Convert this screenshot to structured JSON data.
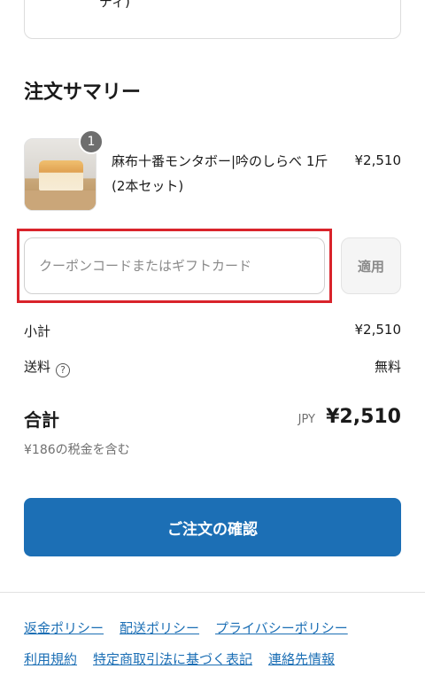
{
  "previous_card": {
    "text": "ディ)"
  },
  "summary": {
    "title": "注文サマリー"
  },
  "product": {
    "quantity": "1",
    "name": "麻布十番モンタボー|吟のしらべ 1斤(2本セット)",
    "price": "¥2,510"
  },
  "coupon": {
    "placeholder": "クーポンコードまたはギフトカード",
    "apply_label": "適用"
  },
  "subtotal": {
    "label": "小計",
    "value": "¥2,510"
  },
  "shipping": {
    "label": "送料",
    "help_icon": "?",
    "value": "無料"
  },
  "total": {
    "label": "合計",
    "currency": "JPY",
    "value": "¥2,510",
    "tax_note": "¥186の税金を含む"
  },
  "confirm_button": {
    "label": "ご注文の確認"
  },
  "footer": {
    "links": [
      "返金ポリシー",
      "配送ポリシー",
      "プライバシーポリシー",
      "利用規約",
      "特定商取引法に基づく表記",
      "連絡先情報"
    ]
  },
  "colors": {
    "primary": "#1c6fb5",
    "highlight": "#d9232b",
    "badge": "#6e6e6e"
  }
}
